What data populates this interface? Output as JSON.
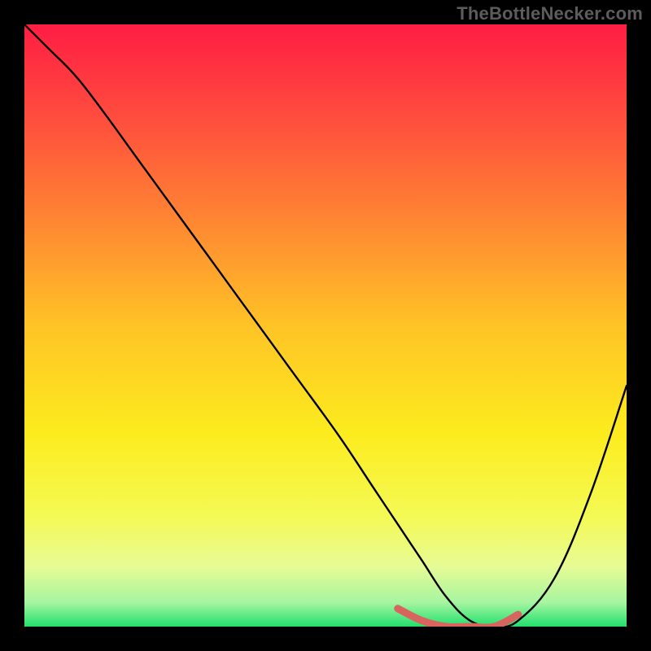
{
  "watermark": "TheBottleNecker.com",
  "chart_data": {
    "type": "line",
    "title": "",
    "xlabel": "",
    "ylabel": "",
    "xlim": [
      0,
      100
    ],
    "ylim": [
      0,
      100
    ],
    "note": "x and y are percentage coordinates over the gradient plot area; y is 'bottleneck %' style value (higher = worse). No numeric axis labels are rendered.",
    "series": [
      {
        "name": "curve-black",
        "color": "#000000",
        "x": [
          0,
          4,
          8,
          12,
          20,
          28,
          36,
          44,
          52,
          58,
          62,
          66,
          70,
          74,
          78,
          82,
          88,
          94,
          100
        ],
        "y": [
          100,
          96,
          92,
          87,
          76,
          65,
          54,
          43,
          32,
          23,
          17,
          11,
          5,
          1,
          0,
          1,
          8,
          22,
          40
        ]
      },
      {
        "name": "optimal-band-red",
        "color": "#d9645f",
        "x": [
          62,
          66,
          70,
          74,
          78,
          82
        ],
        "y": [
          3,
          1,
          0,
          0,
          0,
          2
        ]
      }
    ],
    "gradient_stops": [
      {
        "offset": 0.0,
        "color": "#ff1d44"
      },
      {
        "offset": 0.15,
        "color": "#ff4b3e"
      },
      {
        "offset": 0.32,
        "color": "#ff8433"
      },
      {
        "offset": 0.5,
        "color": "#ffc326"
      },
      {
        "offset": 0.68,
        "color": "#fcec1e"
      },
      {
        "offset": 0.82,
        "color": "#f4fa56"
      },
      {
        "offset": 0.9,
        "color": "#e7fb95"
      },
      {
        "offset": 0.96,
        "color": "#a6f5a0"
      },
      {
        "offset": 1.0,
        "color": "#22e06e"
      }
    ]
  }
}
